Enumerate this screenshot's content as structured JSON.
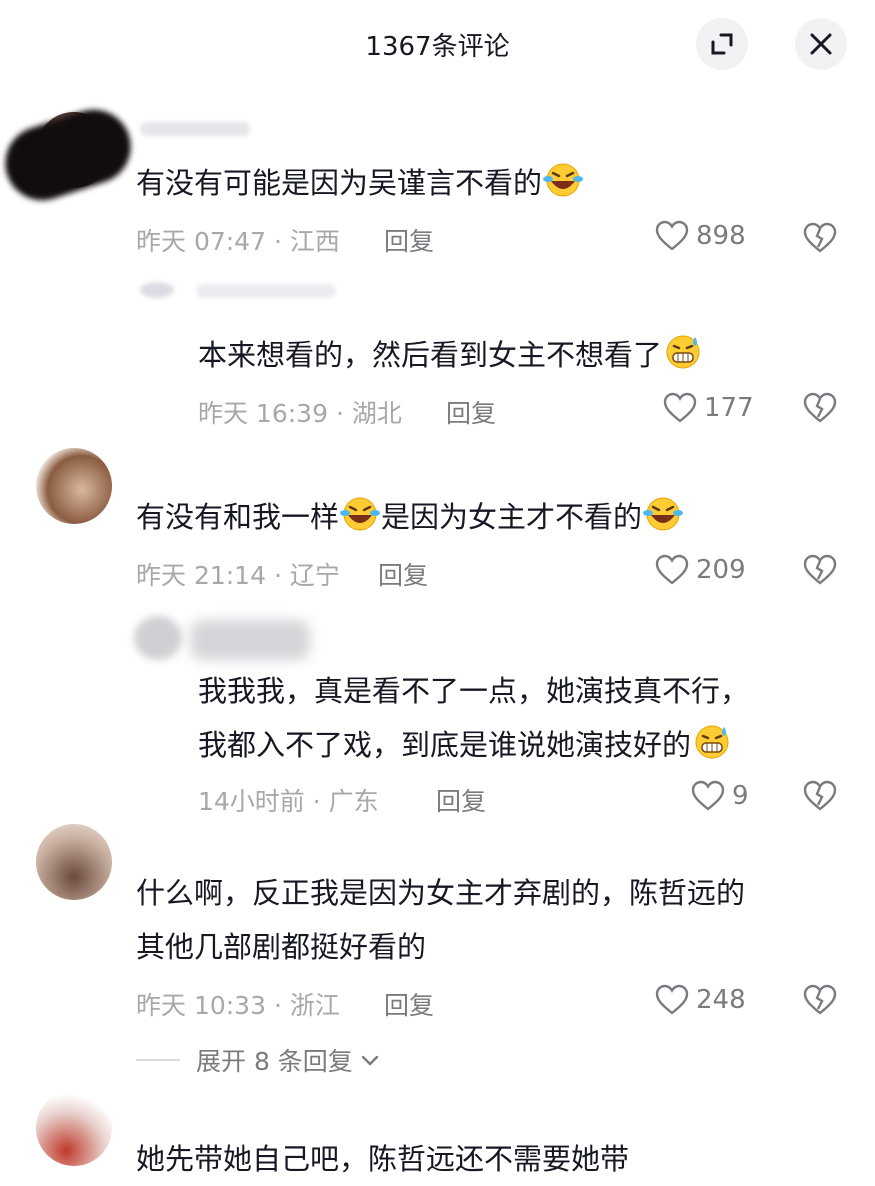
{
  "header": {
    "title": "1367条评论"
  },
  "comments": [
    {
      "text": "有没有可能是因为吴谨言不看的",
      "time": "昨天 07:47 · 江西",
      "reply": "回复",
      "likes": "898"
    },
    {
      "text": "本来想看的，然后看到女主不想看了",
      "time": "昨天 16:39 · 湖北",
      "reply": "回复",
      "likes": "177"
    },
    {
      "text_a": "有没有和我一样",
      "text_b": "是因为女主才不看的",
      "time": "昨天 21:14 · 辽宁",
      "reply": "回复",
      "likes": "209"
    },
    {
      "line1": "我我我，真是看不了一点，她演技真不行，",
      "line2": "我都入不了戏，到底是谁说她演技好的",
      "time": "14小时前 · 广东",
      "reply": "回复",
      "likes": "9"
    },
    {
      "line1": "什么啊，反正我是因为女主才弃剧的，陈哲远的",
      "line2": "其他几部剧都挺好看的",
      "time": "昨天 10:33 · 浙江",
      "reply": "回复",
      "likes": "248"
    },
    {
      "text": "她先带她自己吧，陈哲远还不需要她带"
    }
  ],
  "expand": {
    "label": "展开 8 条回复"
  },
  "icons": {
    "fullscreen": "fullscreen-icon",
    "close": "close-icon",
    "like": "heart-icon",
    "dislike": "broken-heart-icon",
    "emoji_laugh": "laughing-tears-emoji",
    "emoji_sweat": "grin-sweat-emoji"
  }
}
